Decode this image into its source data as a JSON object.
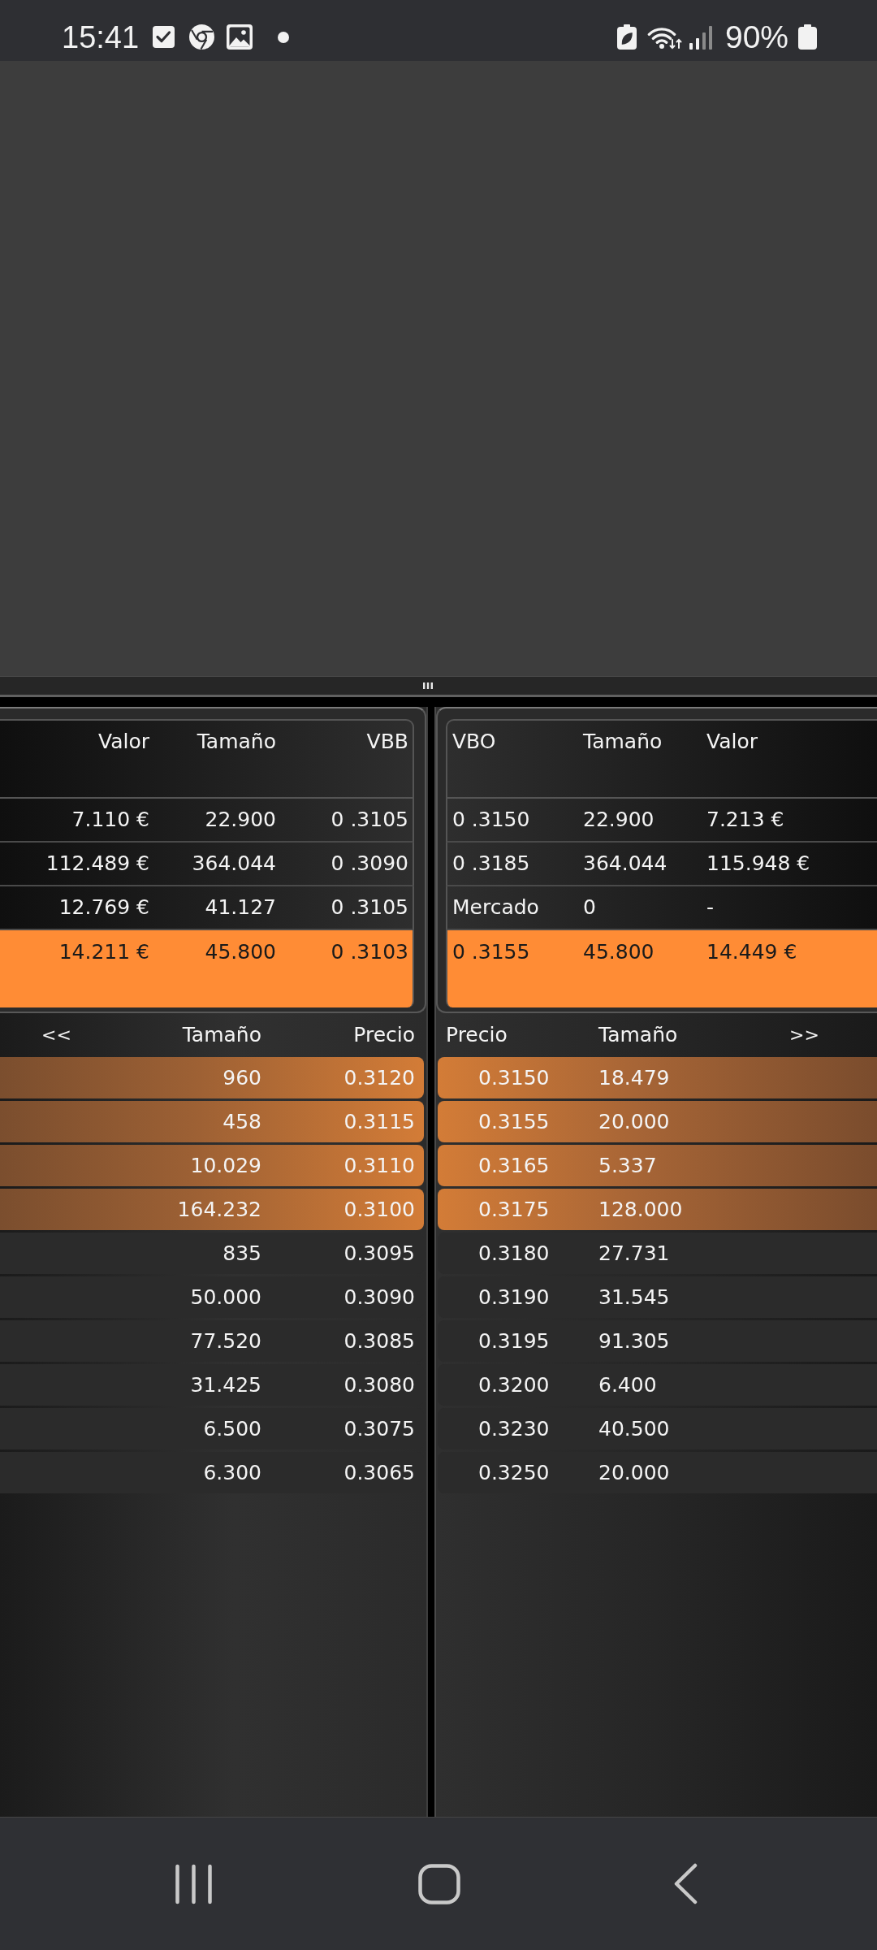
{
  "status_bar": {
    "time": "15:41",
    "battery": "90%"
  },
  "left_panel": {
    "top_table": {
      "columns": [
        "Valor",
        "Tamaño",
        "VBB"
      ],
      "rows": [
        {
          "cells": [
            "7.110 €",
            "22.900",
            "0 .3105"
          ],
          "highlighted": false
        },
        {
          "cells": [
            "112.489 €",
            "364.044",
            "0 .3090"
          ],
          "highlighted": false
        },
        {
          "cells": [
            "12.769 €",
            "41.127",
            "0 .3105"
          ],
          "highlighted": false
        },
        {
          "cells": [
            "14.211 €",
            "45.800",
            "0 .3103"
          ],
          "highlighted": true
        }
      ]
    },
    "order_book": {
      "nav_button": "<<",
      "columns": [
        "Tamaño",
        "Precio"
      ],
      "rows": [
        {
          "cells": [
            "960",
            "0.3120"
          ],
          "highlighted": true
        },
        {
          "cells": [
            "458",
            "0.3115"
          ],
          "highlighted": true
        },
        {
          "cells": [
            "10.029",
            "0.3110"
          ],
          "highlighted": true
        },
        {
          "cells": [
            "164.232",
            "0.3100"
          ],
          "highlighted": true
        },
        {
          "cells": [
            "835",
            "0.3095"
          ],
          "highlighted": false
        },
        {
          "cells": [
            "50.000",
            "0.3090"
          ],
          "highlighted": false
        },
        {
          "cells": [
            "77.520",
            "0.3085"
          ],
          "highlighted": false
        },
        {
          "cells": [
            "31.425",
            "0.3080"
          ],
          "highlighted": false
        },
        {
          "cells": [
            "6.500",
            "0.3075"
          ],
          "highlighted": false
        },
        {
          "cells": [
            "6.300",
            "0.3065"
          ],
          "highlighted": false
        }
      ]
    }
  },
  "right_panel": {
    "top_table": {
      "columns": [
        "VBO",
        "Tamaño",
        "Valor"
      ],
      "rows": [
        {
          "cells": [
            "0 .3150",
            "22.900",
            "7.213 €"
          ],
          "highlighted": false
        },
        {
          "cells": [
            "0 .3185",
            "364.044",
            "115.948 €"
          ],
          "highlighted": false
        },
        {
          "cells": [
            "Mercado",
            "0",
            "-"
          ],
          "highlighted": false
        },
        {
          "cells": [
            "0 .3155",
            "45.800",
            "14.449 €"
          ],
          "highlighted": true
        }
      ]
    },
    "order_book": {
      "nav_button": ">>",
      "columns": [
        "Precio",
        "Tamaño"
      ],
      "rows": [
        {
          "cells": [
            "0.3150",
            "18.479"
          ],
          "highlighted": true
        },
        {
          "cells": [
            "0.3155",
            "20.000"
          ],
          "highlighted": true
        },
        {
          "cells": [
            "0.3165",
            "5.337"
          ],
          "highlighted": true
        },
        {
          "cells": [
            "0.3175",
            "128.000"
          ],
          "highlighted": true
        },
        {
          "cells": [
            "0.3180",
            "27.731"
          ],
          "highlighted": false
        },
        {
          "cells": [
            "0.3190",
            "31.545"
          ],
          "highlighted": false
        },
        {
          "cells": [
            "0.3195",
            "91.305"
          ],
          "highlighted": false
        },
        {
          "cells": [
            "0.3200",
            "6.400"
          ],
          "highlighted": false
        },
        {
          "cells": [
            "0.3230",
            "40.500"
          ],
          "highlighted": false
        },
        {
          "cells": [
            "0.3250",
            "20.000"
          ],
          "highlighted": false
        }
      ]
    }
  }
}
